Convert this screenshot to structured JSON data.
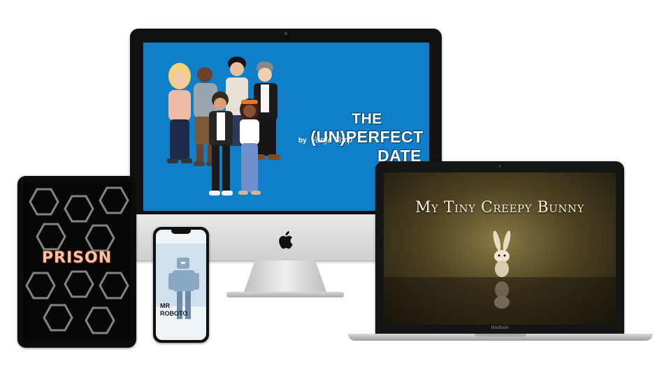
{
  "imac": {
    "title_lines": [
      "THE",
      "(UN)PERFECT",
      "DATE"
    ],
    "byline_prefix": "by",
    "byline_author": "Vanja Torp",
    "screen_color": "#0f7fc9"
  },
  "macbook": {
    "title": "My Tiny Creepy Bunny",
    "brand": "MacBook"
  },
  "ipad": {
    "title": "PRISON"
  },
  "iphone": {
    "title_line1": "MR",
    "title_line2": "ROBOTO"
  },
  "icons": [
    "apple-logo-icon"
  ]
}
